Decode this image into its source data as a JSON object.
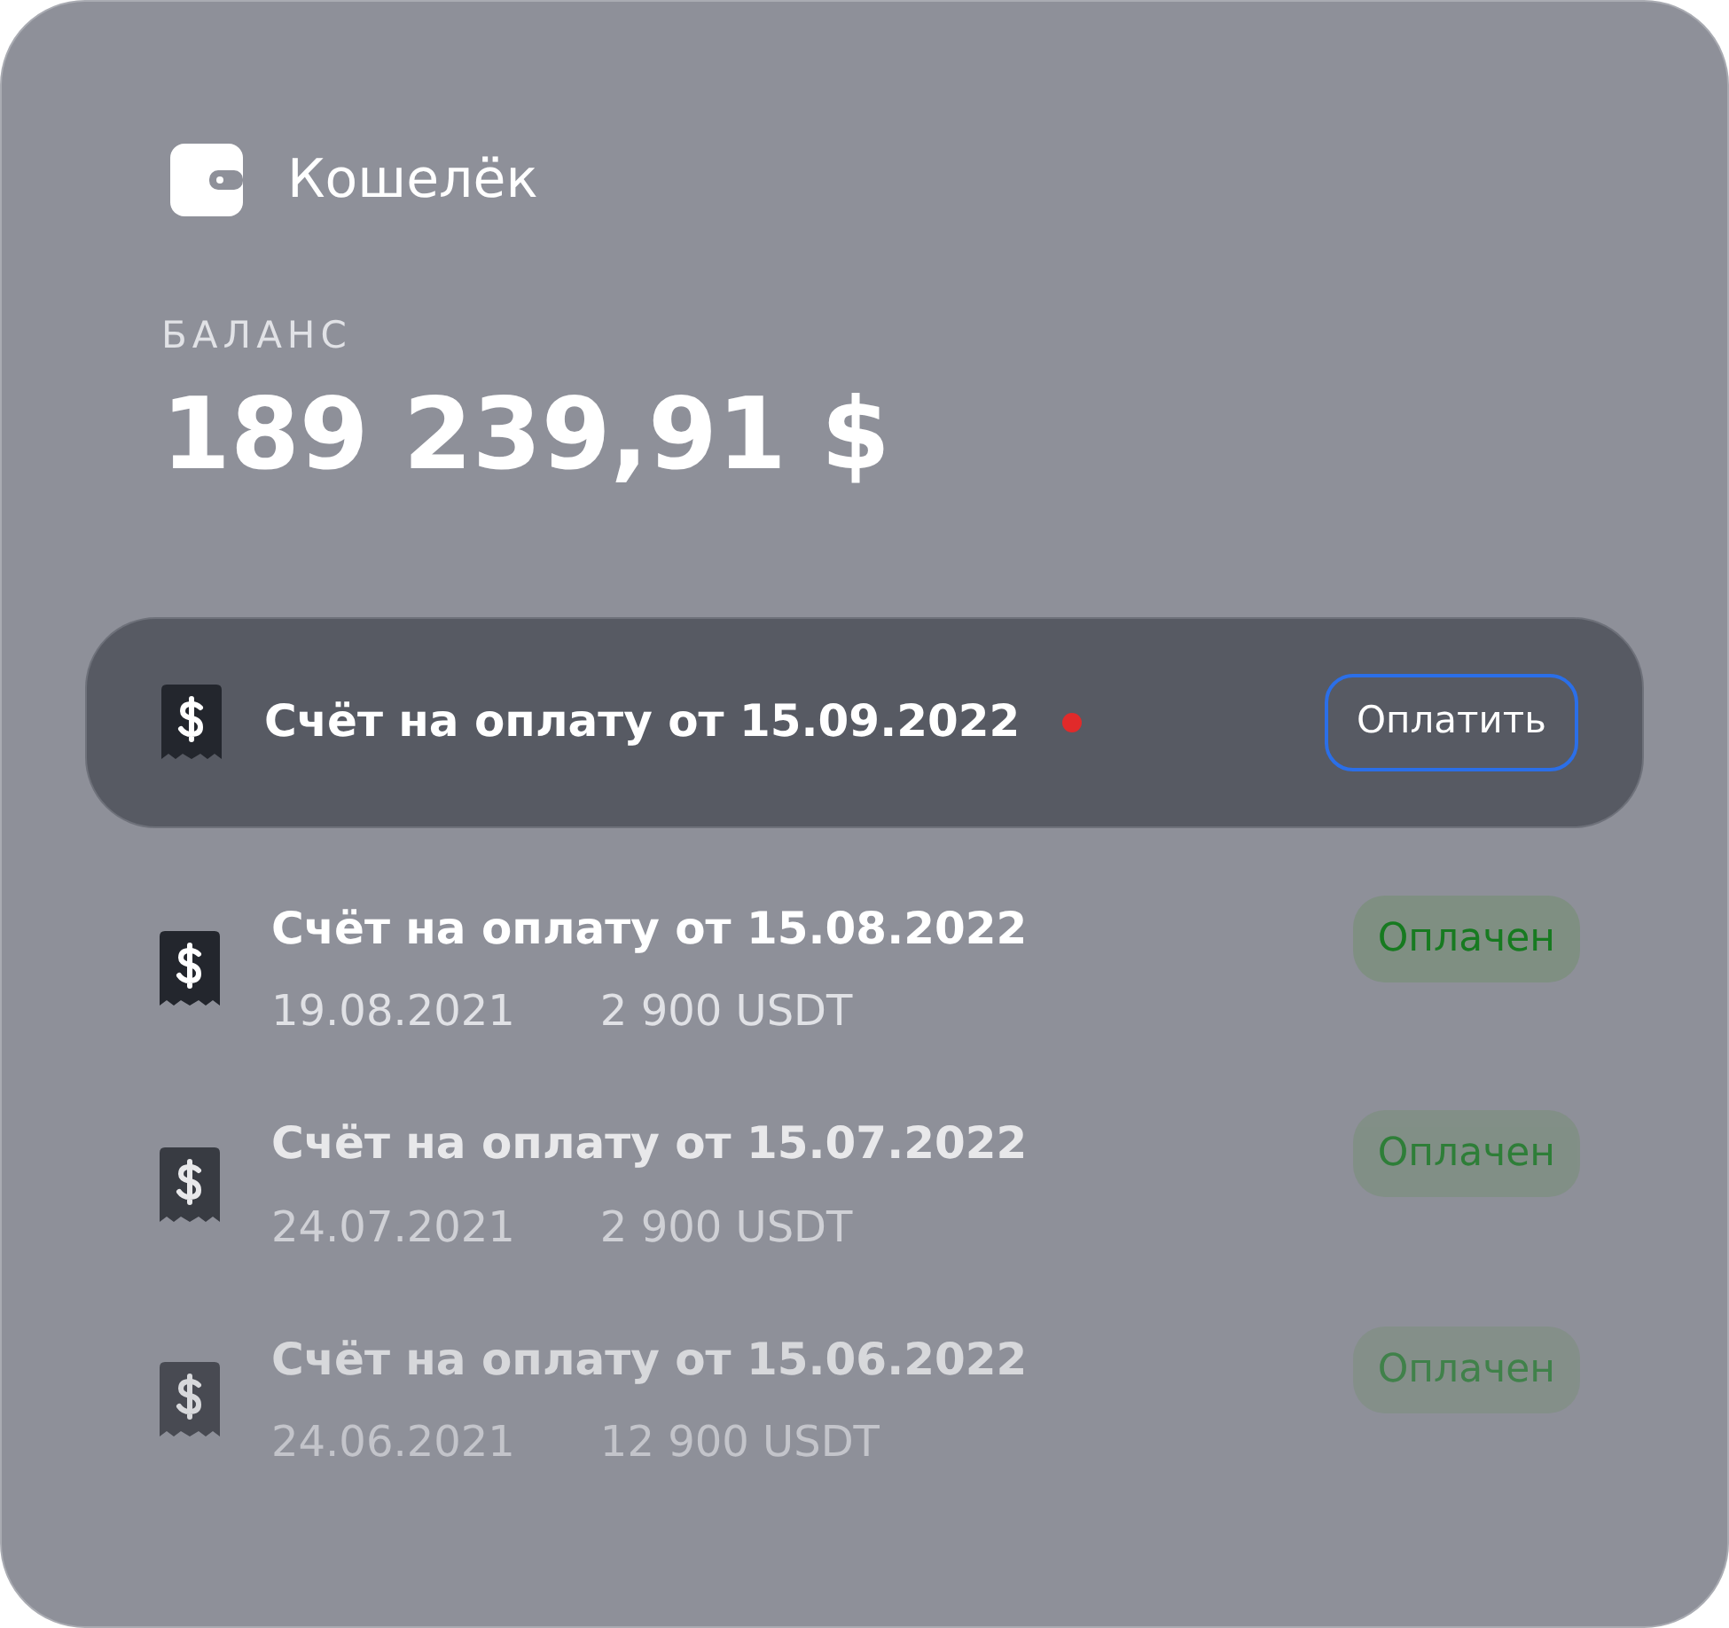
{
  "header": {
    "title": "Кошелёк"
  },
  "balance": {
    "label": "БАЛАНС",
    "amount": "189 239,91 $"
  },
  "pending_invoice": {
    "title": "Счёт на оплату от 15.09.2022",
    "unread": true,
    "button": "Оплатить"
  },
  "invoices": [
    {
      "title": "Счёт на оплату от 15.08.2022",
      "date": "19.08.2021",
      "amount": "2 900 USDT",
      "status": "Оплачен"
    },
    {
      "title": "Счёт на оплату от 15.07.2022",
      "date": "24.07.2021",
      "amount": "2 900 USDT",
      "status": "Оплачен"
    },
    {
      "title": "Счёт на оплату от 15.06.2022",
      "date": "24.06.2021",
      "amount": "12 900 USDT",
      "status": "Оплачен"
    }
  ]
}
